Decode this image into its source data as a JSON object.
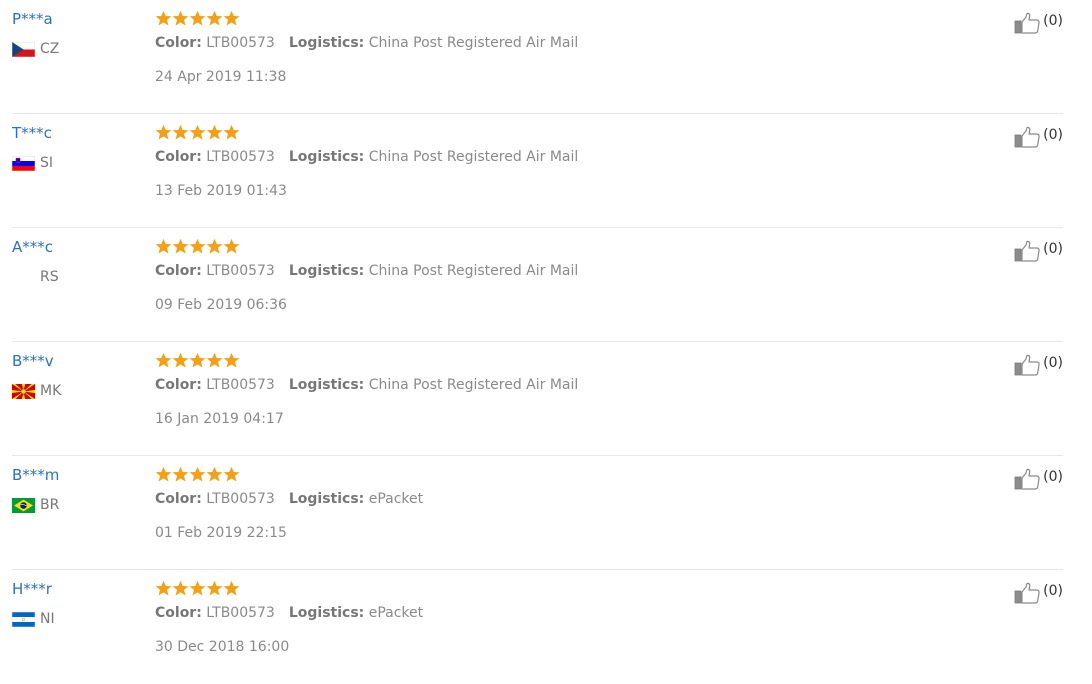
{
  "colors": {
    "user_link": "#2e6fc8",
    "star": "#f5a012",
    "text_muted": "#8a8a8a",
    "divider": "#e8e8e8"
  },
  "labels": {
    "color_key": "Color:",
    "logistics_key": "Logistics:"
  },
  "reviews": [
    {
      "user": "P***a",
      "flag": "cz-flag",
      "country": "CZ",
      "stars": 5,
      "color": "LTB00573",
      "logistics": "China Post Registered Air Mail",
      "date": "24 Apr 2019 11:38",
      "helpful": "(0)"
    },
    {
      "user": "T***c",
      "flag": "si-flag",
      "country": "SI",
      "stars": 5,
      "color": "LTB00573",
      "logistics": "China Post Registered Air Mail",
      "date": "13 Feb 2019 01:43",
      "helpful": "(0)"
    },
    {
      "user": "A***c",
      "flag": "none",
      "country": "RS",
      "stars": 5,
      "color": "LTB00573",
      "logistics": "China Post Registered Air Mail",
      "date": "09 Feb 2019 06:36",
      "helpful": "(0)"
    },
    {
      "user": "B***v",
      "flag": "mk-flag",
      "country": "MK",
      "stars": 5,
      "color": "LTB00573",
      "logistics": "China Post Registered Air Mail",
      "date": "16 Jan 2019 04:17",
      "helpful": "(0)"
    },
    {
      "user": "B***m",
      "flag": "br-flag",
      "country": "BR",
      "stars": 5,
      "color": "LTB00573",
      "logistics": "ePacket",
      "date": "01 Feb 2019 22:15",
      "helpful": "(0)"
    },
    {
      "user": "H***r",
      "flag": "ni-flag",
      "country": "NI",
      "stars": 5,
      "color": "LTB00573",
      "logistics": "ePacket",
      "date": "30 Dec 2018 16:00",
      "helpful": "(0)"
    }
  ]
}
